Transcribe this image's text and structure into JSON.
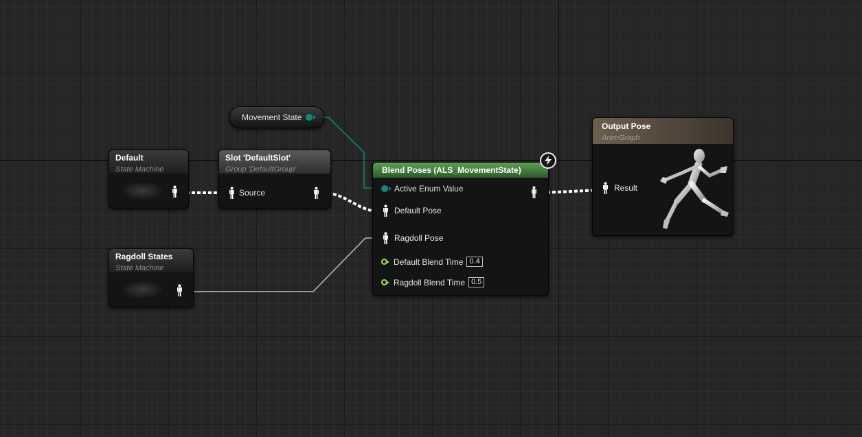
{
  "graph": {
    "nodes": {
      "default_sm": {
        "title": "Default",
        "subtitle": "State Machine"
      },
      "slot": {
        "title": "Slot 'DefaultSlot'",
        "subtitle": "Group 'DefaultGroup'",
        "source_label": "Source"
      },
      "movement_state": {
        "label": "Movement State"
      },
      "blend_poses": {
        "title": "Blend Poses (ALS_MovementState)",
        "active_enum_label": "Active Enum Value",
        "default_pose_label": "Default Pose",
        "ragdoll_pose_label": "Ragdoll Pose",
        "default_blend_label": "Default Blend Time",
        "default_blend_value": "0.4",
        "ragdoll_blend_label": "Ragdoll Blend Time",
        "ragdoll_blend_value": "0.5"
      },
      "ragdoll_sm": {
        "title": "Ragdoll States",
        "subtitle": "State Machine"
      },
      "output_pose": {
        "title": "Output Pose",
        "subtitle": "AnimGraph",
        "result_label": "Result"
      }
    },
    "icons": {
      "pose_pin": "pose-pin-icon",
      "enum_pin": "enum-pin-icon",
      "exec_pin": "float-pin-icon",
      "fast_path": "lightning-icon",
      "mannequin": "mannequin-preview-icon"
    },
    "colors": {
      "pose_wire": "#ffffff",
      "enum_wire": "#0f8a78",
      "float_pin": "#a2ec3b",
      "blend_header": "#5f9e56",
      "output_header": "#6b5f4f"
    }
  }
}
